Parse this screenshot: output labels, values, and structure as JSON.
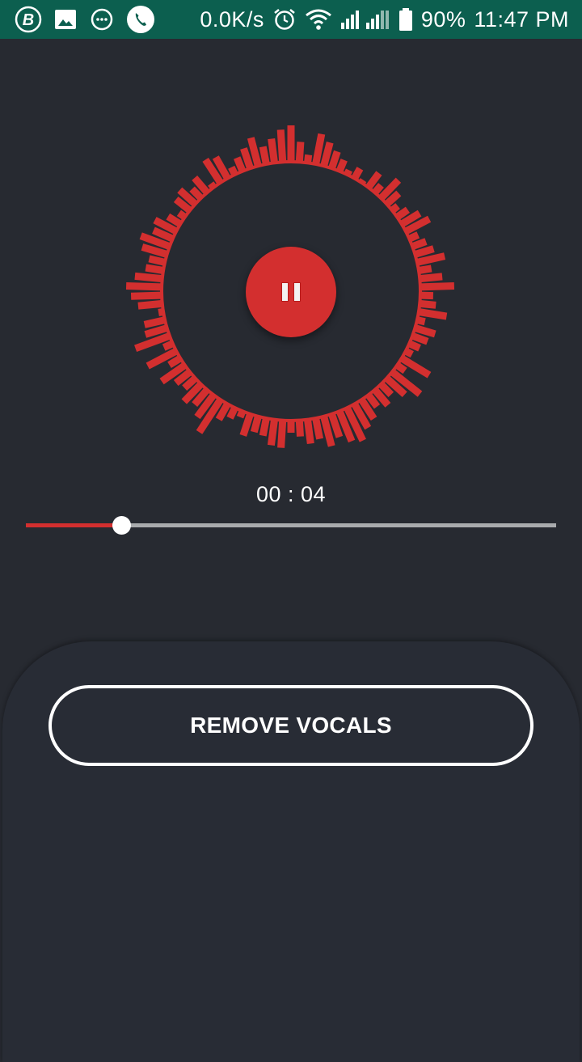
{
  "status_bar": {
    "net_speed": "0.0K/s",
    "battery": "90%",
    "time": "11:47 PM",
    "background": "#0c5f4f",
    "left_icons": [
      "b-app-icon",
      "image-icon",
      "message-icon",
      "phone-icon"
    ],
    "right_icons": [
      "alarm-icon",
      "wifi-icon",
      "signal-icon",
      "signal-icon",
      "battery-icon"
    ]
  },
  "player": {
    "elapsed": "00 : 04",
    "progress": 0.18,
    "state": "playing",
    "control_icon": "pause-icon",
    "accent": "#d32f2f",
    "background": "#272a31",
    "visualizer_bars": [
      45,
      25,
      10,
      38,
      30,
      22,
      15,
      6,
      14,
      4,
      22,
      12,
      31,
      20,
      9,
      16,
      26,
      33,
      12,
      18,
      24,
      35,
      16,
      28,
      42,
      16,
      20,
      35,
      10,
      26,
      20,
      14,
      9,
      40,
      12,
      44,
      30,
      18,
      25,
      18,
      28,
      34,
      45,
      40,
      30,
      38,
      26,
      30,
      20,
      15,
      34,
      32,
      22,
      20,
      28,
      8,
      14,
      22,
      48,
      34,
      24,
      30,
      18,
      22,
      35,
      16,
      40,
      12,
      45,
      28,
      26,
      6,
      30,
      38,
      44,
      34,
      22,
      20,
      32,
      38,
      26,
      30,
      18,
      9,
      22,
      26,
      16,
      24,
      6,
      34,
      30,
      10,
      18,
      26,
      36,
      22,
      30,
      40
    ]
  },
  "actions": {
    "remove_vocals_label": "REMOVE VOCALS"
  }
}
